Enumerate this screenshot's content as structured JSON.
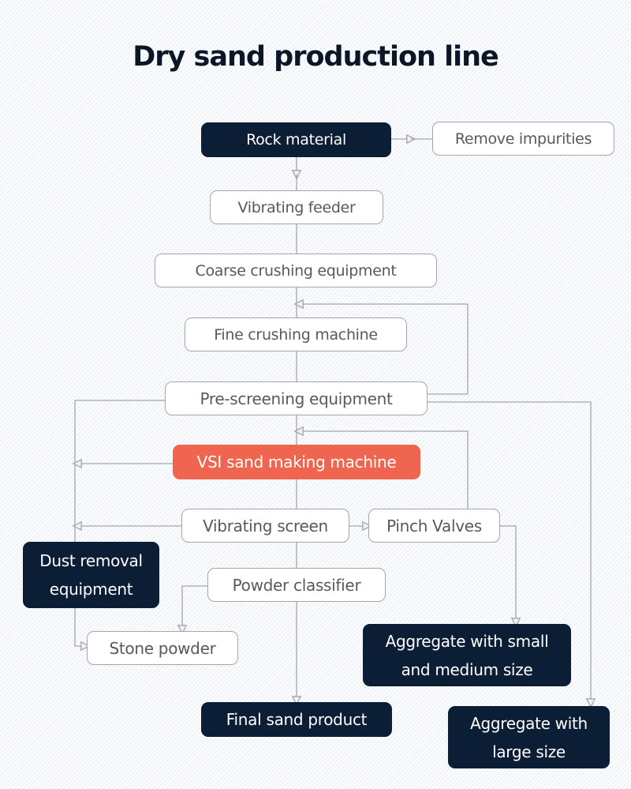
{
  "title": "Dry sand production line",
  "colors": {
    "dark_node": "#0b1e36",
    "accent_node": "#f0654f",
    "light_node_border": "#a3a6ab",
    "connector": "#a3a6ab"
  },
  "nodes": {
    "rock_material": "Rock material",
    "remove_impurities": "Remove impurities",
    "vibrating_feeder": "Vibrating feeder",
    "coarse_crushing": "Coarse crushing equipment",
    "fine_crushing": "Fine crushing machine",
    "pre_screening": "Pre-screening equipment",
    "vsi": "VSI sand making machine",
    "vibrating_screen": "Vibrating screen",
    "pinch_valves": "Pinch Valves",
    "dust_removal": "Dust removal equipment",
    "powder_classifier": "Powder classifier",
    "stone_powder": "Stone powder",
    "aggregate_small_medium": "Aggregate with small and medium size",
    "final_sand": "Final sand product",
    "aggregate_large": "Aggregate with large size"
  },
  "edges": [
    {
      "from": "Rock material",
      "to": "Remove impurities"
    },
    {
      "from": "Rock material",
      "to": "Vibrating feeder"
    },
    {
      "from": "Vibrating feeder",
      "to": "Coarse crushing equipment"
    },
    {
      "from": "Coarse crushing equipment",
      "to": "Fine crushing machine"
    },
    {
      "from": "Fine crushing machine",
      "to": "Pre-screening equipment"
    },
    {
      "from": "Pre-screening equipment",
      "to": "Fine crushing machine"
    },
    {
      "from": "Pre-screening equipment",
      "to": "VSI sand making machine"
    },
    {
      "from": "Pre-screening equipment",
      "to": "Stone powder"
    },
    {
      "from": "Pre-screening equipment",
      "to": "Aggregate with large size"
    },
    {
      "from": "VSI sand making machine",
      "to": "Stone powder"
    },
    {
      "from": "VSI sand making machine",
      "to": "Vibrating screen"
    },
    {
      "from": "Vibrating screen",
      "to": "Stone powder"
    },
    {
      "from": "Vibrating screen",
      "to": "Pinch Valves"
    },
    {
      "from": "Pinch Valves",
      "to": "VSI sand making machine"
    },
    {
      "from": "Pinch Valves",
      "to": "Aggregate with small and medium size"
    },
    {
      "from": "Vibrating screen",
      "to": "Powder classifier"
    },
    {
      "from": "Powder classifier",
      "to": "Stone powder"
    },
    {
      "from": "Powder classifier",
      "to": "Final sand product"
    }
  ]
}
